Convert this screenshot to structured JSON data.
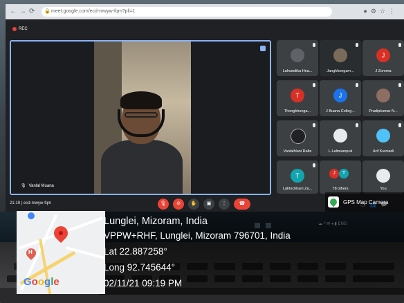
{
  "browser": {
    "url": "meet.google.com/ecd-mwyw-fqm?pli=1"
  },
  "meeting": {
    "recording_label": "REC",
    "code": "ecd-mwyw-fqm",
    "time": "21:19",
    "main_speaker": "Vanlal Muana",
    "participants": [
      {
        "name": "Lalnundika Hna...",
        "initial": "",
        "color": "#5f6368"
      },
      {
        "name": "Jangkhongam...",
        "initial": "",
        "color": "#5f6368"
      },
      {
        "name": "J Zorema",
        "initial": "J",
        "color": "#d93025"
      },
      {
        "name": "Thongkhonga...",
        "initial": "T",
        "color": "#d93025"
      },
      {
        "name": "J Buana Colleg...",
        "initial": "J",
        "color": "#1a73e8"
      },
      {
        "name": "Pradipkumar N...",
        "initial": "",
        "color": "#5f6368"
      },
      {
        "name": "Vanlalhlani Ralte",
        "initial": "",
        "color": "#5f6368"
      },
      {
        "name": "L.Lalmuanpuii",
        "initial": "",
        "color": "#5f6368"
      },
      {
        "name": "Arif Kurniadi",
        "initial": "",
        "color": "#5f6368"
      },
      {
        "name": "Lalrinchhani Za...",
        "initial": "T",
        "color": "#12a4af"
      },
      {
        "name": "78 others",
        "initial": "J",
        "color": "#d93025"
      },
      {
        "name": "You",
        "initial": "",
        "color": "#5f6368"
      }
    ]
  },
  "gps": {
    "brand": "GPS Map Camera",
    "place": "Lunglei, Mizoram, India",
    "address": "VPPW+RHF, Lunglei, Mizoram 796701, India",
    "lat": "Lat 22.887258°",
    "long": "Long 92.745644°",
    "datetime": "02/11/21 09:19 PM",
    "map_logo": "Google"
  },
  "colors": {
    "accent": "#8ab4f8",
    "end_call": "#ea4335"
  }
}
